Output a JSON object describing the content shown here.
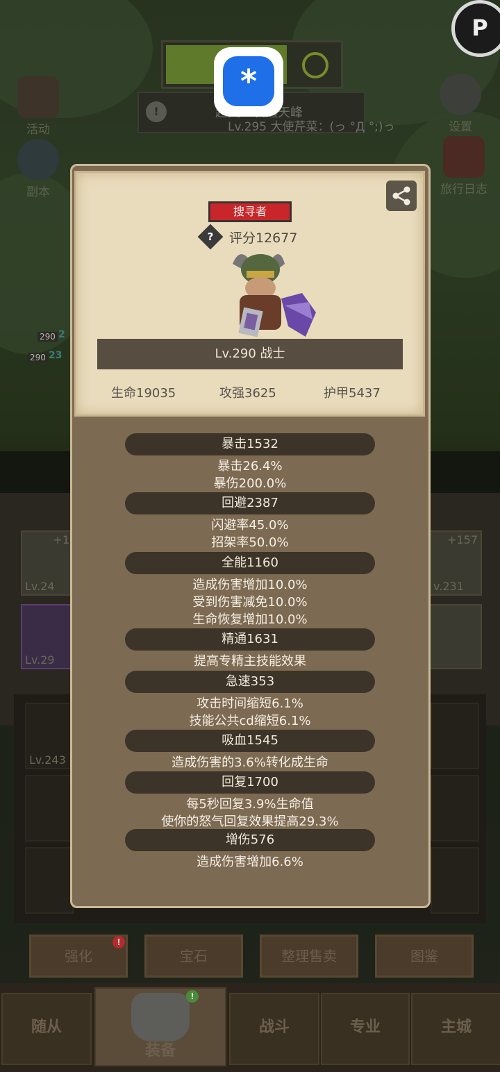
{
  "background": {
    "corner_button": "P",
    "info_line1": "超天⋯次通天峰",
    "info_line2": "Lv.295 大使芹菜：(っ °Д °;)っ",
    "left_buttons": [
      {
        "label": "活动",
        "icon": "activity-icon"
      },
      {
        "label": "副本",
        "icon": "dungeon-icon"
      }
    ],
    "right_buttons": [
      {
        "label": "设置",
        "icon": "gear-icon"
      },
      {
        "label": "旅行日志",
        "icon": "journal-icon"
      }
    ],
    "level_tags": [
      {
        "lv": "290",
        "num": "2"
      },
      {
        "lv": "290",
        "num": "23"
      }
    ],
    "equipment_slots": [
      {
        "level": "Lv.24",
        "plus": "+1"
      },
      {
        "level": "Lv.29",
        "plus": ""
      },
      {
        "level": "v.231",
        "plus": "+157"
      },
      {
        "level": "Lv.243",
        "plus": ""
      }
    ],
    "action_buttons": [
      "强化",
      "宝石",
      "整理售卖",
      "图鉴"
    ],
    "nav_tabs": [
      "随从",
      "装备",
      "战斗",
      "专业",
      "主城"
    ],
    "active_tab": "装备"
  },
  "panel": {
    "class_tag": "搜寻者",
    "score": "评分12677",
    "level_banner": "Lv.290 战士",
    "base_stats": [
      "生命19035",
      "攻强3625",
      "护甲5437"
    ],
    "sections": [
      {
        "header": "暴击1532",
        "lines": [
          "暴击26.4%",
          "暴伤200.0%"
        ]
      },
      {
        "header": "回避2387",
        "lines": [
          "闪避率45.0%",
          "招架率50.0%"
        ]
      },
      {
        "header": "全能1160",
        "lines": [
          "造成伤害增加10.0%",
          "受到伤害减免10.0%",
          "生命恢复增加10.0%"
        ]
      },
      {
        "header": "精通1631",
        "lines": [
          "提高专精主技能效果"
        ]
      },
      {
        "header": "急速353",
        "lines": [
          "攻击时间缩短6.1%",
          "技能公共cd缩短6.1%"
        ]
      },
      {
        "header": "吸血1545",
        "lines": [
          "造成伤害的3.6%转化成生命"
        ]
      },
      {
        "header": "回复1700",
        "lines": [
          "每5秒回复3.9%生命值",
          "使你的怒气回复效果提高29.3%"
        ]
      },
      {
        "header": "增伤576",
        "lines": [
          "造成伤害增加6.6%"
        ]
      }
    ]
  }
}
